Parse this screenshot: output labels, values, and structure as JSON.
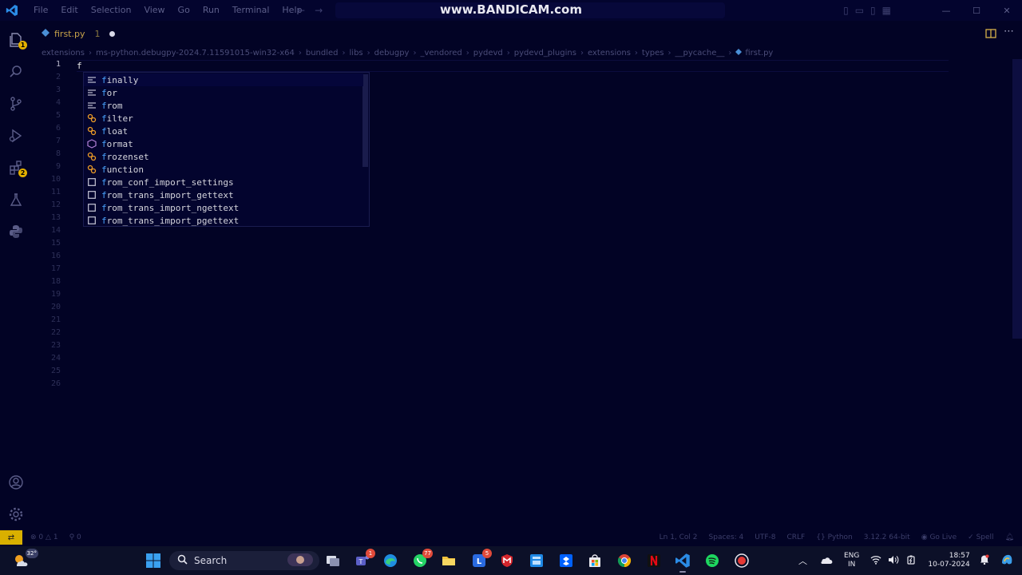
{
  "titlebar": {
    "menu": [
      "File",
      "Edit",
      "Selection",
      "View",
      "Go",
      "Run",
      "Terminal",
      "Help"
    ],
    "watermark": "www.BANDICAM.com"
  },
  "tab": {
    "filename": "first.py",
    "problems": "1"
  },
  "breadcrumb": [
    "extensions",
    "ms-python.debugpy-2024.7.11591015-win32-x64",
    "bundled",
    "libs",
    "debugpy",
    "_vendored",
    "pydevd",
    "pydevd_plugins",
    "extensions",
    "types",
    "__pycache__",
    "first.py"
  ],
  "editor": {
    "line_numbers": [
      "1",
      "2",
      "3",
      "4",
      "5",
      "6",
      "7",
      "8",
      "9",
      "10",
      "11",
      "12",
      "13",
      "14",
      "15",
      "16",
      "17",
      "18",
      "19",
      "20",
      "21",
      "22",
      "23",
      "24",
      "25",
      "26"
    ],
    "line1_text": "f"
  },
  "suggestions": [
    {
      "match": "f",
      "rest": "inally",
      "kind": "keyword"
    },
    {
      "match": "f",
      "rest": "or",
      "kind": "keyword"
    },
    {
      "match": "f",
      "rest": "rom",
      "kind": "keyword"
    },
    {
      "match": "f",
      "rest": "ilter",
      "kind": "class"
    },
    {
      "match": "f",
      "rest": "loat",
      "kind": "class"
    },
    {
      "match": "f",
      "rest": "ormat",
      "kind": "function"
    },
    {
      "match": "f",
      "rest": "rozenset",
      "kind": "class"
    },
    {
      "match": "f",
      "rest": "unction",
      "kind": "class"
    },
    {
      "match": "f",
      "rest": "rom_conf_import_settings",
      "kind": "snippet"
    },
    {
      "match": "f",
      "rest": "rom_trans_import_gettext",
      "kind": "snippet"
    },
    {
      "match": "f",
      "rest": "rom_trans_import_ngettext",
      "kind": "snippet"
    },
    {
      "match": "f",
      "rest": "rom_trans_import_pgettext",
      "kind": "snippet"
    }
  ],
  "statusbar": {
    "errors": "0",
    "warnings": "1",
    "ports": "0",
    "position": "Ln 1, Col 2",
    "spaces": "Spaces: 4",
    "encoding": "UTF-8",
    "eol": "CRLF",
    "language": "Python",
    "interpreter": "3.12.2 64-bit",
    "golive": "Go Live",
    "spell": "Spell"
  },
  "taskbar": {
    "weather": "32°",
    "search_label": "Search",
    "teams_badge": "1",
    "whatsapp_badge": "77",
    "files_badge": "5",
    "lang_top": "ENG",
    "lang_bottom": "IN",
    "time": "18:57",
    "date": "10-07-2024"
  },
  "colors": {
    "background": "#020325",
    "accent_yellow": "#d9b000",
    "match_blue": "#49a4ff"
  }
}
